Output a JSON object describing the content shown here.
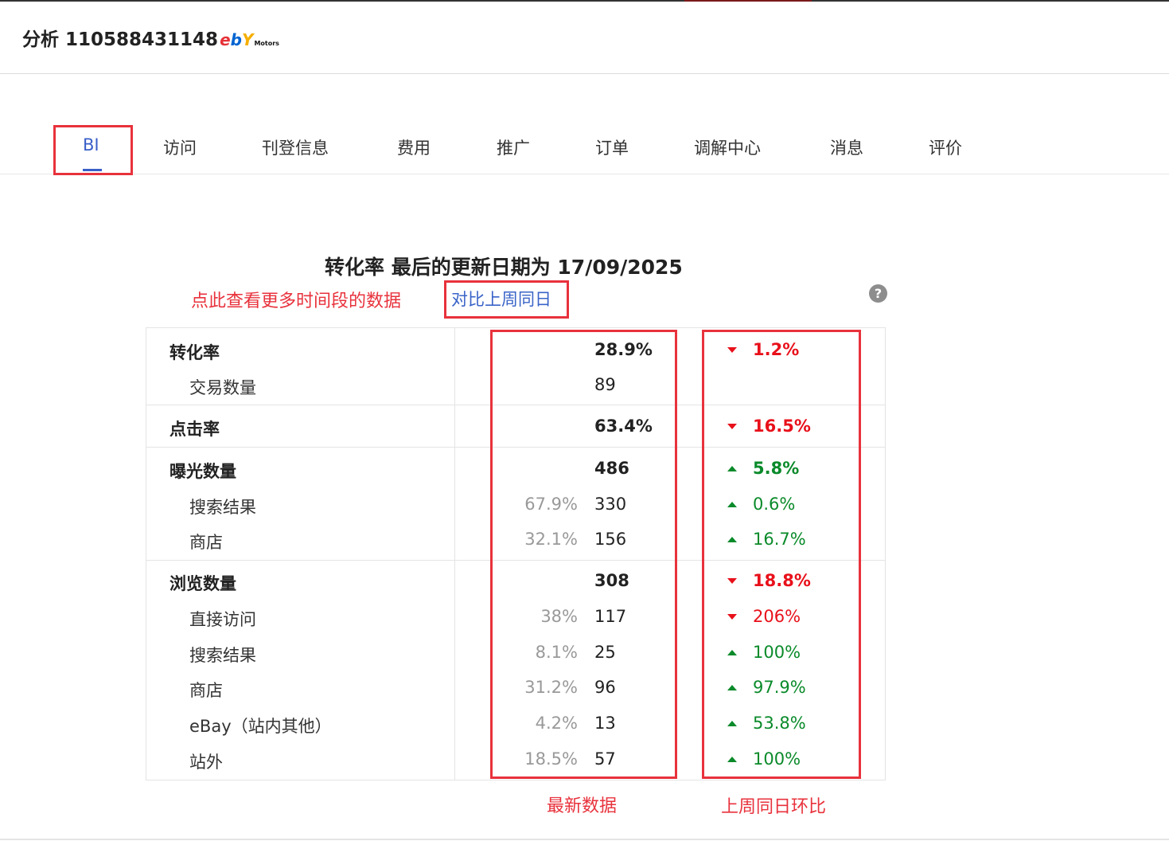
{
  "header": {
    "title": "分析 110588431148",
    "logo": {
      "e": "e",
      "b": "b",
      "y": "Y",
      "m": "Motors"
    }
  },
  "tabs": [
    {
      "label": "BI",
      "active": true
    },
    {
      "label": "访问"
    },
    {
      "label": "刊登信息"
    },
    {
      "label": "费用"
    },
    {
      "label": "推广"
    },
    {
      "label": "订单"
    },
    {
      "label": "调解中心"
    },
    {
      "label": "消息"
    },
    {
      "label": "评价"
    }
  ],
  "report": {
    "title": "转化率 最后的更新日期为 17/09/2025",
    "note": "点此查看更多时间段的数据",
    "compare_link": "对比上周同日",
    "help_glyph": "?"
  },
  "rows": [
    {
      "label": "转化率",
      "main": true,
      "pct": "",
      "value": "28.9%",
      "trend": "down",
      "change": "1.2%"
    },
    {
      "label": "交易数量",
      "main": false,
      "pct": "",
      "value": "89",
      "trend": "",
      "change": ""
    },
    {
      "label": "点击率",
      "main": true,
      "pct": "",
      "value": "63.4%",
      "trend": "down",
      "change": "16.5%"
    },
    {
      "label": "曝光数量",
      "main": true,
      "pct": "",
      "value": "486",
      "trend": "up",
      "change": "5.8%"
    },
    {
      "label": "搜索结果",
      "main": false,
      "pct": "67.9%",
      "value": "330",
      "trend": "up",
      "change": "0.6%"
    },
    {
      "label": "商店",
      "main": false,
      "pct": "32.1%",
      "value": "156",
      "trend": "up",
      "change": "16.7%"
    },
    {
      "label": "浏览数量",
      "main": true,
      "pct": "",
      "value": "308",
      "trend": "down",
      "change": "18.8%"
    },
    {
      "label": "直接访问",
      "main": false,
      "pct": "38%",
      "value": "117",
      "trend": "down",
      "change": "206%"
    },
    {
      "label": "搜索结果",
      "main": false,
      "pct": "8.1%",
      "value": "25",
      "trend": "up",
      "change": "100%"
    },
    {
      "label": "商店",
      "main": false,
      "pct": "31.2%",
      "value": "96",
      "trend": "up",
      "change": "97.9%"
    },
    {
      "label": "eBay（站内其他）",
      "main": false,
      "pct": "4.2%",
      "value": "13",
      "trend": "up",
      "change": "53.8%"
    },
    {
      "label": "站外",
      "main": false,
      "pct": "18.5%",
      "value": "57",
      "trend": "up",
      "change": "100%"
    }
  ],
  "annotations": {
    "latest_caption": "最新数据",
    "compare_caption": "上周同日环比"
  },
  "colors": {
    "accent": "#3a5fc8",
    "annotation_red": "#e8323c",
    "up_green": "#0a8a2a",
    "down_red": "#e8101a"
  }
}
